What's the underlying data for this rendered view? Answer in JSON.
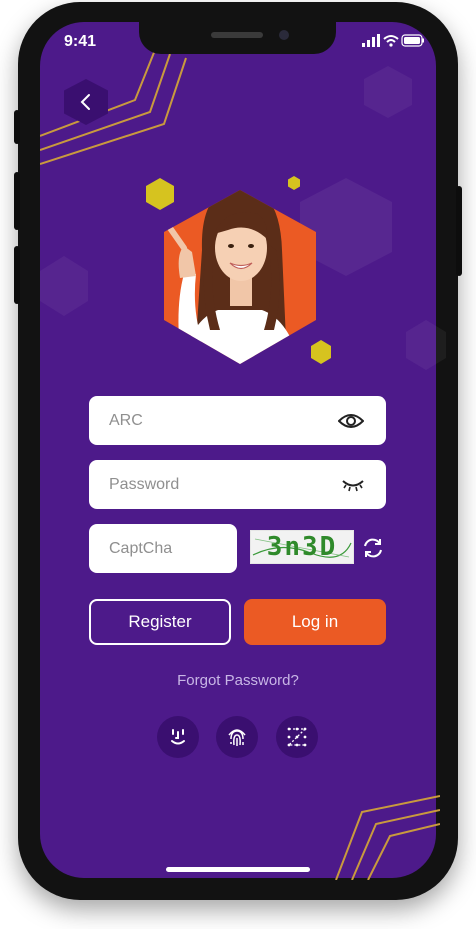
{
  "status_bar": {
    "time": "9:41"
  },
  "form": {
    "arc_placeholder": "ARC",
    "password_placeholder": "Password",
    "captcha_placeholder": "CaptCha",
    "captcha_code": "3n3D"
  },
  "actions": {
    "register_label": "Register",
    "login_label": "Log in",
    "forgot_label": "Forgot Password?"
  },
  "biometrics": [
    "face-id-icon",
    "fingerprint-icon",
    "pattern-icon"
  ],
  "colors": {
    "background": "#4d1a8a",
    "accent": "#eb5a24",
    "hexagon_yellow": "#d6c31f",
    "button_dark": "#3a0f70"
  }
}
